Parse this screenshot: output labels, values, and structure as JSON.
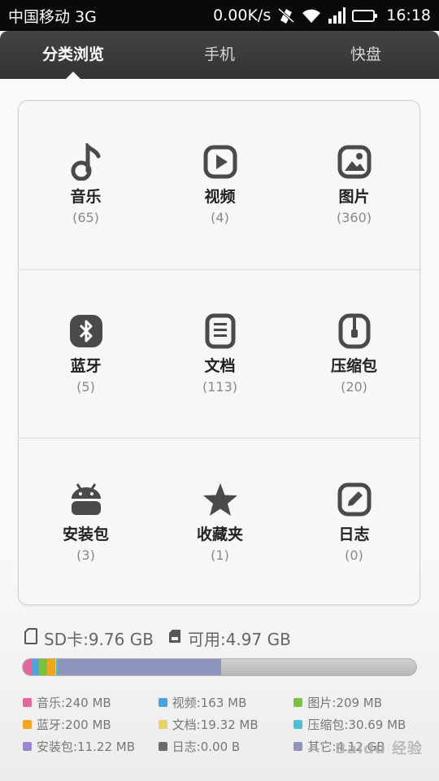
{
  "status_bar": {
    "carrier": "中国移动 3G",
    "speed": "0.00K/s",
    "time": "16:18"
  },
  "tabs": [
    {
      "label": "分类浏览",
      "active": true
    },
    {
      "label": "手机",
      "active": false
    },
    {
      "label": "快盘",
      "active": false
    }
  ],
  "categories": [
    {
      "name": "音乐",
      "count": "(65)",
      "icon": "music-note-icon"
    },
    {
      "name": "视频",
      "count": "(4)",
      "icon": "video-play-icon"
    },
    {
      "name": "图片",
      "count": "(360)",
      "icon": "image-icon"
    },
    {
      "name": "蓝牙",
      "count": "(5)",
      "icon": "bluetooth-icon"
    },
    {
      "name": "文档",
      "count": "(113)",
      "icon": "document-icon"
    },
    {
      "name": "压缩包",
      "count": "(20)",
      "icon": "zip-icon"
    },
    {
      "name": "安装包",
      "count": "(3)",
      "icon": "android-icon"
    },
    {
      "name": "收藏夹",
      "count": "(1)",
      "icon": "star-icon"
    },
    {
      "name": "日志",
      "count": "(0)",
      "icon": "edit-log-icon"
    }
  ],
  "storage": {
    "sd_label": "SD卡:9.76 GB",
    "free_label": "可用:4.97 GB",
    "used_fraction": 0.49,
    "segments": [
      {
        "color": "#e0689a",
        "fraction": 0.025
      },
      {
        "color": "#4ba3e0",
        "fraction": 0.017
      },
      {
        "color": "#7cc242",
        "fraction": 0.021
      },
      {
        "color": "#f0a51e",
        "fraction": 0.02
      },
      {
        "color": "#e8d36a",
        "fraction": 0.002
      },
      {
        "color": "#4fc0d4",
        "fraction": 0.003
      },
      {
        "color": "#9b86cf",
        "fraction": 0.001
      },
      {
        "color": "#8e95bc",
        "fraction": 0.416
      }
    ]
  },
  "legend": [
    [
      {
        "label": "音乐:240 MB",
        "color": "#e0689a"
      },
      {
        "label": "视频:163 MB",
        "color": "#4ba3e0"
      },
      {
        "label": "图片:209 MB",
        "color": "#7cc242"
      }
    ],
    [
      {
        "label": "蓝牙:200 MB",
        "color": "#f0a51e"
      },
      {
        "label": "文档:19.32 MB",
        "color": "#e8d36a"
      },
      {
        "label": "压缩包:30.69 MB",
        "color": "#4fc0d4"
      }
    ],
    [
      {
        "label": "安装包:11.22 MB",
        "color": "#9b86cf"
      },
      {
        "label": "日志:0.00 B",
        "color": "#6b6b6b"
      },
      {
        "label": "其它:4.12 GB",
        "color": "#8e95bc"
      }
    ]
  ],
  "colors": {
    "icon": "#4a4a4a",
    "tab_bg": "#3a3b3d"
  }
}
